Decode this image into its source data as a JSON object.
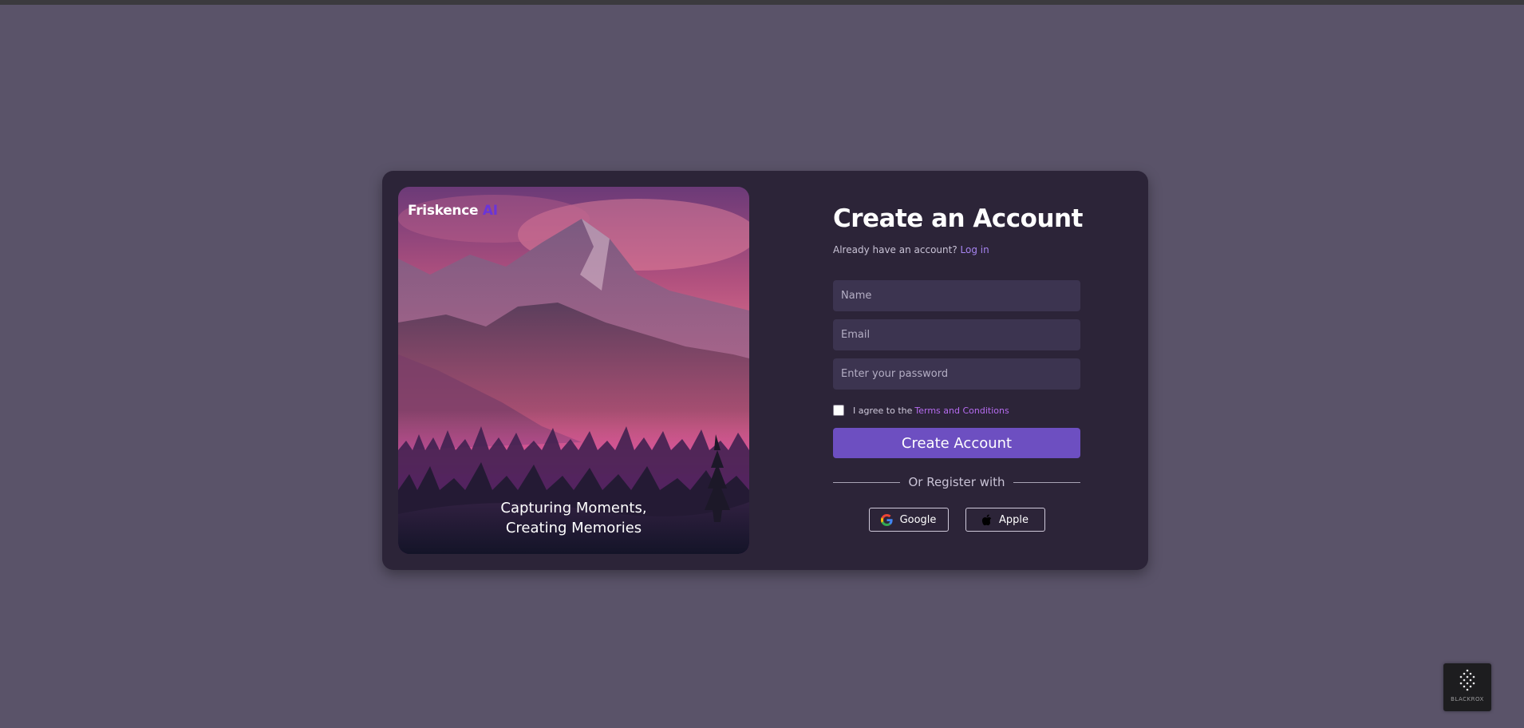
{
  "brand": {
    "name": "Friskence",
    "suffix": "AI"
  },
  "hero": {
    "tagline_line1": "Capturing Moments,",
    "tagline_line2": "Creating Memories"
  },
  "form": {
    "title": "Create an Account",
    "already_text": "Already have an account?",
    "login_link": "Log in",
    "name_placeholder": "Name",
    "email_placeholder": "Email",
    "password_placeholder": "Enter your password",
    "agree_text": "I agree to the",
    "terms_link": "Terms and Conditions",
    "terms_checked": false,
    "submit_label": "Create Account",
    "divider_text": "Or Register with",
    "google_label": "Google",
    "apple_label": "Apple"
  },
  "watermark": {
    "label": "BLACKROX"
  },
  "colors": {
    "accent": "#6d4fc1",
    "link": "#a684f0",
    "brand_ai": "#6a35d8",
    "card": "#2c2438",
    "page": "#5a5369"
  },
  "icons": {
    "google": "google-logo-icon",
    "apple": "apple-logo-icon"
  }
}
